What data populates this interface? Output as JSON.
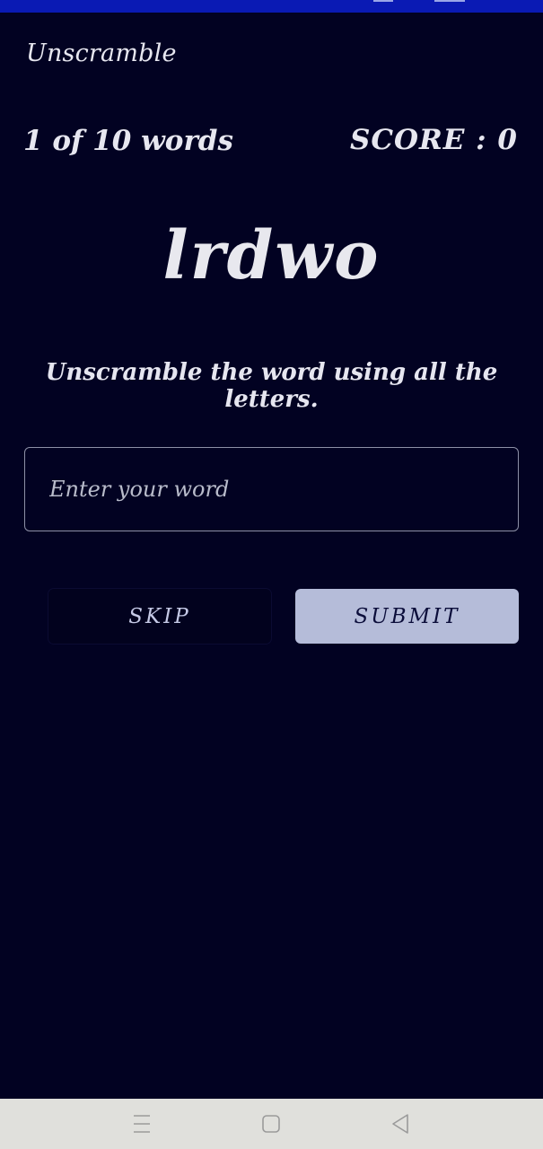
{
  "app": {
    "title": "Unscramble"
  },
  "game": {
    "progress": "1 of 10 words",
    "score_label": "SCORE : 0",
    "scrambled_word": "lrdwo",
    "instructions": "Unscramble the word using all the letters."
  },
  "input": {
    "placeholder": "Enter your word",
    "value": ""
  },
  "buttons": {
    "skip_label": "SKIP",
    "submit_label": "SUBMIT"
  },
  "system_nav": {
    "recents_icon": "menu-lines-icon",
    "home_icon": "square-home-icon",
    "back_icon": "triangle-back-icon"
  },
  "colors": {
    "background": "#020222",
    "status_bar": "#0a1ab4",
    "submit_button": "#b5bcd9",
    "text": "#e7e7f0"
  }
}
